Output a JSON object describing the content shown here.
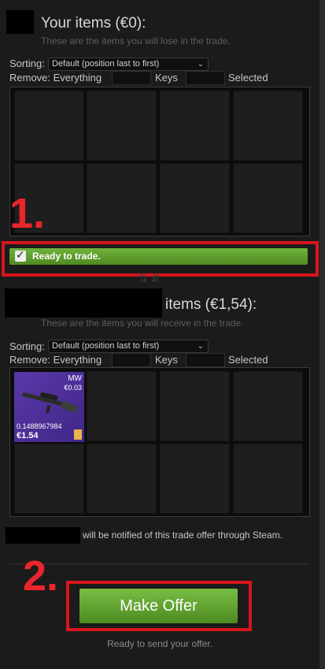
{
  "your_items": {
    "title": "Your items (€0):",
    "subtitle": "These are the items you will lose in the trade.",
    "sorting_label": "Sorting:",
    "sorting_value": "Default (position last to first)",
    "remove_label": "Remove: Everything",
    "keys_label": "Keys",
    "selected_label": "Selected"
  },
  "annotation_one": "1.",
  "ready": {
    "label": "Ready to trade.",
    "checked": true
  },
  "their_items": {
    "title": "items (€1,54):",
    "subtitle": "These are the items you will receive in the trade.",
    "sorting_label": "Sorting:",
    "sorting_value": "Default (position last to first)",
    "remove_label": "Remove: Everything",
    "keys_label": "Keys",
    "selected_label": "Selected",
    "item": {
      "wear": "MW",
      "sticker_price": "€0.03",
      "float": "0.1488967984",
      "price": "€1.54"
    }
  },
  "notify_text": "will be notified of this trade offer through Steam.",
  "annotation_two": "2.",
  "make_offer_label": "Make Offer",
  "status_text": "Ready to send your offer.",
  "colors": {
    "ready_green": "#5c9c2c",
    "annotation_red": "#e8262b",
    "item_purple": "#4b2f97"
  }
}
